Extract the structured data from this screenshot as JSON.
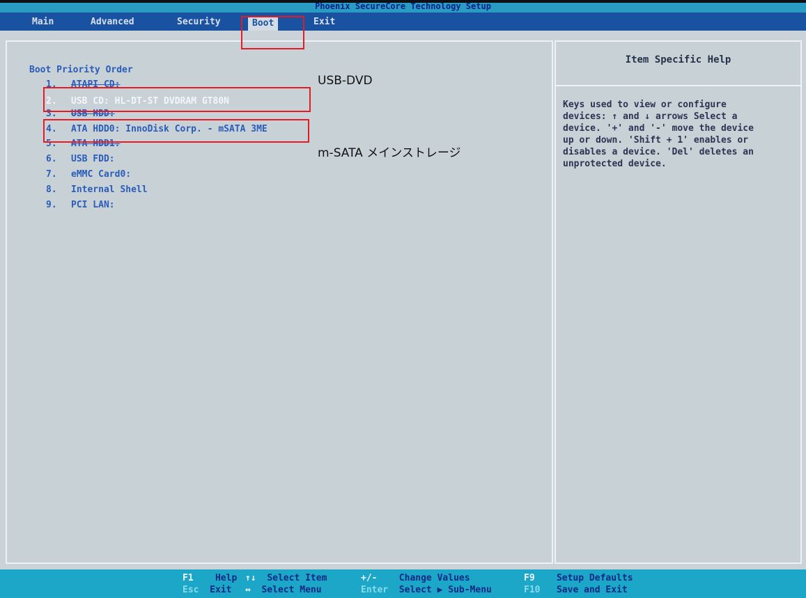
{
  "title": "Phoenix SecureCore Technology Setup",
  "menu": [
    {
      "label": "Main",
      "active": false
    },
    {
      "label": "Advanced",
      "active": false
    },
    {
      "label": "Security",
      "active": false
    },
    {
      "label": "Boot",
      "active": true
    },
    {
      "label": "Exit",
      "active": false
    }
  ],
  "boot": {
    "section_title": "Boot Priority Order",
    "items": [
      {
        "num": "1.",
        "label": "ATAPI CD:"
      },
      {
        "num": "2.",
        "label": "USB CD: HL-DT-ST DVDRAM GT80N"
      },
      {
        "num": "3.",
        "label": "USB HDD:"
      },
      {
        "num": "4.",
        "label": "ATA HDD0: InnoDisk Corp. - mSATA 3ME"
      },
      {
        "num": "5.",
        "label": "ATA HDD1:"
      },
      {
        "num": "6.",
        "label": "USB FDD:"
      },
      {
        "num": "7.",
        "label": "eMMC Card0:"
      },
      {
        "num": "8.",
        "label": "Internal Shell"
      },
      {
        "num": "9.",
        "label": "PCI LAN:"
      }
    ]
  },
  "help": {
    "title": "Item Specific Help",
    "text": "Keys used to view or configure\ndevices: ↑ and ↓ arrows Select a\ndevice. '+' and '-' move the device\nup or down. 'Shift + 1' enables or\ndisables a device. 'Del' deletes an\nunprotected device."
  },
  "annotations": {
    "usb_dvd": "USB-DVD",
    "msata": "m-SATA メインストレージ"
  },
  "footer": {
    "row1": [
      {
        "key": "F1",
        "desc": "Help"
      },
      {
        "key": "↑↓",
        "desc": "Select Item"
      },
      {
        "key": "+/-",
        "desc": "Change Values"
      },
      {
        "key": "F9",
        "desc": "Setup Defaults"
      }
    ],
    "row2": [
      {
        "key": "Esc",
        "desc": "Exit"
      },
      {
        "key": "↔",
        "desc": "Select Menu"
      },
      {
        "key": "Enter",
        "desc": "Select ▶ Sub-Menu"
      },
      {
        "key": "F10",
        "desc": "Save and Exit"
      }
    ]
  },
  "colors": {
    "menu_bar": "#1a52a2",
    "title_bar": "#2a9cc4",
    "footer": "#1ca7c9",
    "annotation": "#e21b24"
  }
}
